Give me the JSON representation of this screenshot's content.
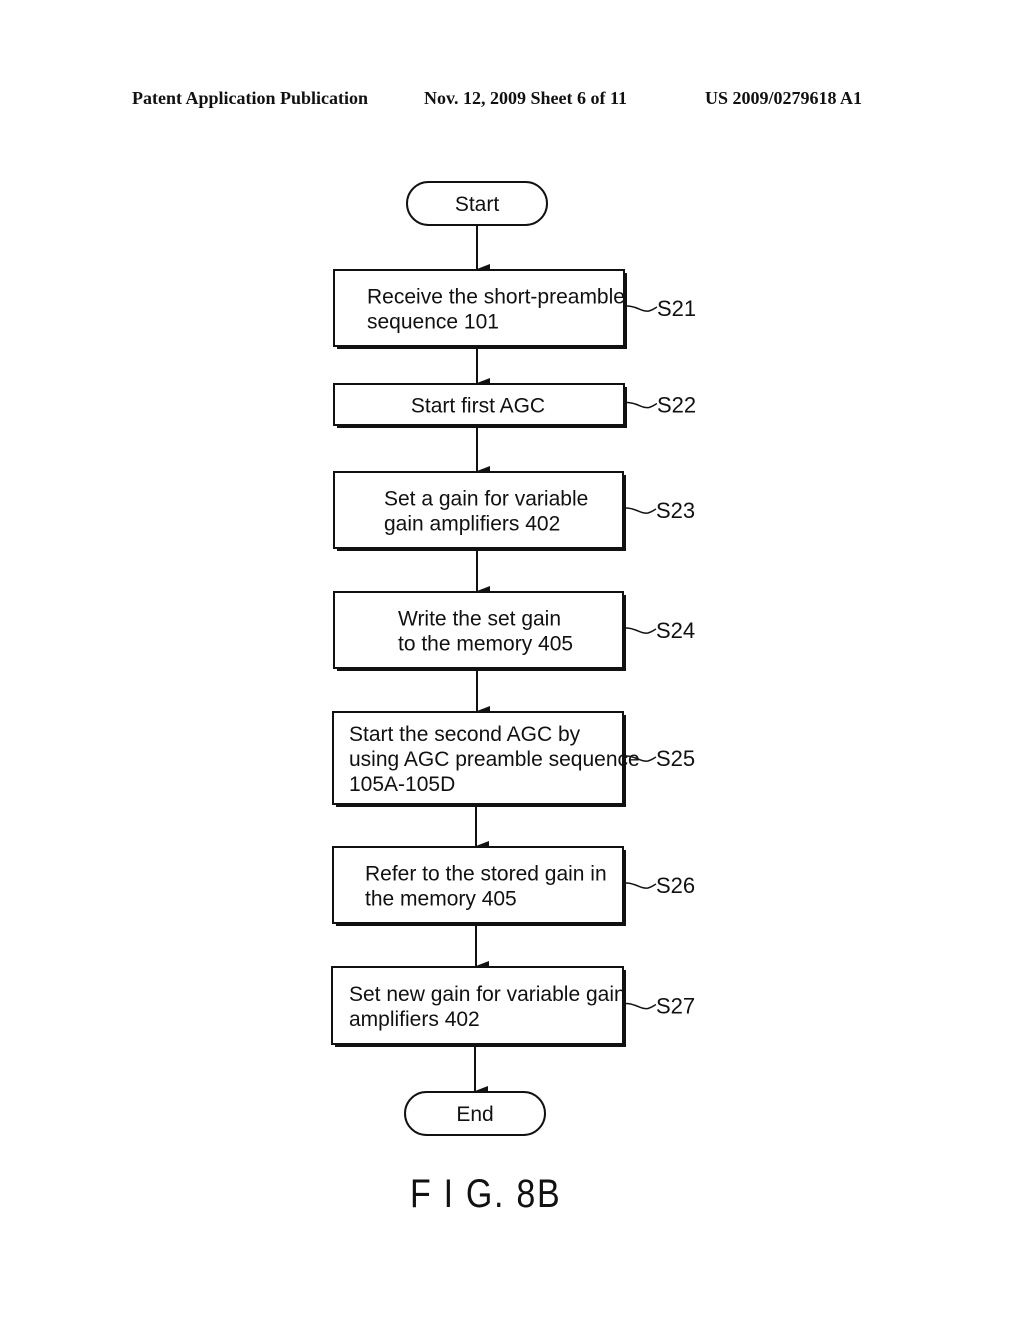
{
  "header": {
    "left": "Patent Application Publication",
    "middle": "Nov. 12, 2009   Sheet 6 of 11",
    "right": "US 2009/0279618 A1"
  },
  "flowchart": {
    "start": "Start",
    "end": "End",
    "steps": [
      {
        "id": "S21",
        "lines": [
          "Receive the short-preamble",
          "sequence 101"
        ]
      },
      {
        "id": "S22",
        "lines": [
          "Start first AGC"
        ]
      },
      {
        "id": "S23",
        "lines": [
          "Set a gain for variable",
          "gain amplifiers 402"
        ]
      },
      {
        "id": "S24",
        "lines": [
          "Write the set gain",
          "to the memory 405"
        ]
      },
      {
        "id": "S25",
        "lines": [
          "Start the second AGC by",
          "using AGC preamble sequence",
          "105A-105D"
        ]
      },
      {
        "id": "S26",
        "lines": [
          "Refer to the stored gain in",
          "the memory 405"
        ]
      },
      {
        "id": "S27",
        "lines": [
          "Set new gain for variable gain",
          "amplifiers 402"
        ]
      }
    ]
  },
  "figure_label": "F I G. 8B"
}
